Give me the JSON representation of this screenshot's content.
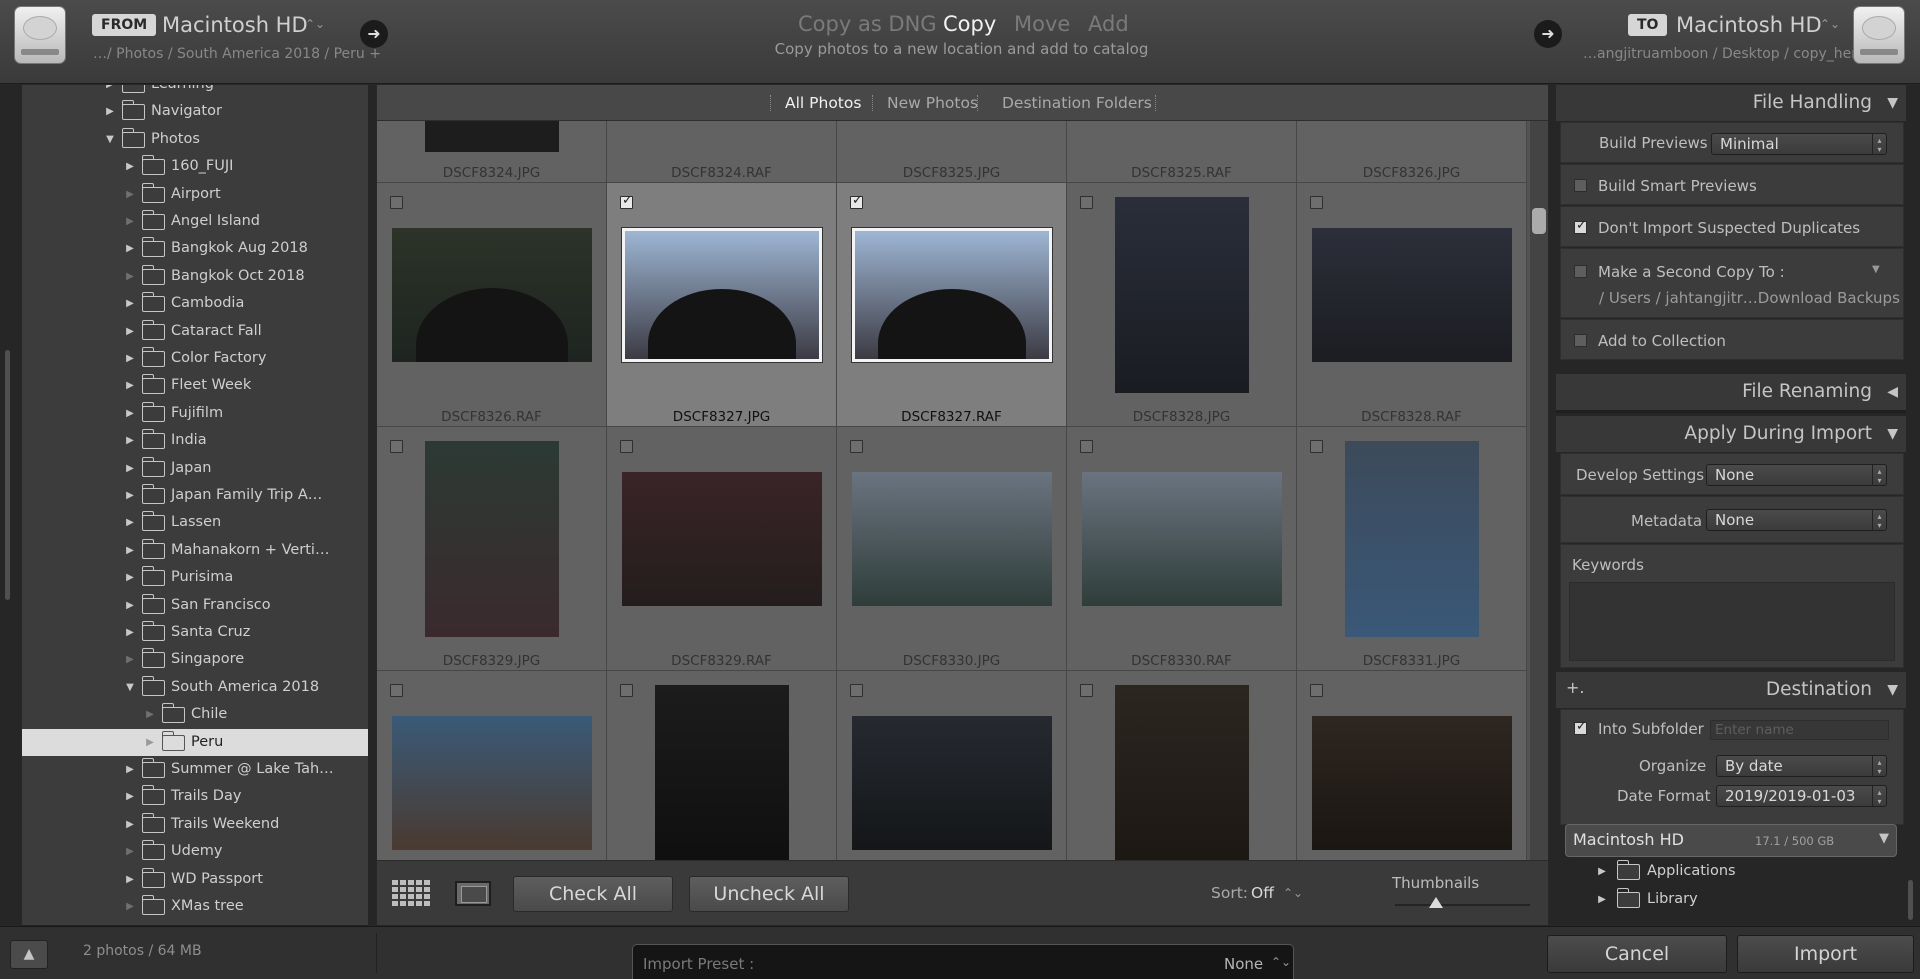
{
  "header": {
    "from_tag": "FROM",
    "from_volume": "Macintosh HD",
    "from_path": "…/ Photos / South America 2018 / Peru +",
    "modes": [
      "Copy as DNG",
      "Copy",
      "Move",
      "Add"
    ],
    "active_mode": "Copy",
    "mode_description": "Copy photos to a new location and add to catalog",
    "to_tag": "TO",
    "to_volume": "Macintosh HD",
    "to_path": "…angjitruamboon / Desktop / copy_here"
  },
  "source_tree": [
    {
      "label": "Learning",
      "depth": 1,
      "expander": "closed"
    },
    {
      "label": "Navigator",
      "depth": 1,
      "expander": "closed"
    },
    {
      "label": "Photos",
      "depth": 1,
      "expander": "open"
    },
    {
      "label": "160_FUJI",
      "depth": 2,
      "expander": "closed"
    },
    {
      "label": "Airport",
      "depth": 2,
      "expander": "none"
    },
    {
      "label": "Angel Island",
      "depth": 2,
      "expander": "none"
    },
    {
      "label": "Bangkok Aug 2018",
      "depth": 2,
      "expander": "closed"
    },
    {
      "label": "Bangkok Oct 2018",
      "depth": 2,
      "expander": "none"
    },
    {
      "label": "Cambodia",
      "depth": 2,
      "expander": "closed"
    },
    {
      "label": "Cataract Fall",
      "depth": 2,
      "expander": "closed"
    },
    {
      "label": "Color Factory",
      "depth": 2,
      "expander": "closed"
    },
    {
      "label": "Fleet Week",
      "depth": 2,
      "expander": "closed"
    },
    {
      "label": "Fujifilm",
      "depth": 2,
      "expander": "closed"
    },
    {
      "label": "India",
      "depth": 2,
      "expander": "closed"
    },
    {
      "label": "Japan",
      "depth": 2,
      "expander": "closed"
    },
    {
      "label": "Japan Family Trip  A…",
      "depth": 2,
      "expander": "closed"
    },
    {
      "label": "Lassen",
      "depth": 2,
      "expander": "closed"
    },
    {
      "label": "Mahanakorn + Verti…",
      "depth": 2,
      "expander": "closed"
    },
    {
      "label": "Purisima",
      "depth": 2,
      "expander": "closed"
    },
    {
      "label": "San Francisco",
      "depth": 2,
      "expander": "closed"
    },
    {
      "label": "Santa Cruz",
      "depth": 2,
      "expander": "closed"
    },
    {
      "label": "Singapore",
      "depth": 2,
      "expander": "none"
    },
    {
      "label": "South America 2018",
      "depth": 2,
      "expander": "open"
    },
    {
      "label": "Chile",
      "depth": 3,
      "expander": "none"
    },
    {
      "label": "Peru",
      "depth": 3,
      "expander": "none",
      "selected": true
    },
    {
      "label": "Summer @ Lake Tah…",
      "depth": 2,
      "expander": "closed"
    },
    {
      "label": "Trails Day",
      "depth": 2,
      "expander": "closed"
    },
    {
      "label": "Trails Weekend",
      "depth": 2,
      "expander": "closed"
    },
    {
      "label": "Udemy",
      "depth": 2,
      "expander": "none"
    },
    {
      "label": "WD Passport",
      "depth": 2,
      "expander": "closed"
    },
    {
      "label": "XMas tree",
      "depth": 2,
      "expander": "none"
    }
  ],
  "view_tabs": [
    "All Photos",
    "New Photos",
    "Destination Folders"
  ],
  "active_view_tab": "All Photos",
  "photos_top_row": [
    "DSCF8324.JPG",
    "DSCF8324.RAF",
    "DSCF8325.JPG",
    "DSCF8325.RAF",
    "DSCF8326.JPG"
  ],
  "photos": [
    {
      "name": "DSCF8326.RAF",
      "checked": false,
      "orientation": "landscape",
      "tone": [
        "#2c3328",
        "#1e2420"
      ]
    },
    {
      "name": "DSCF8327.JPG",
      "checked": true,
      "orientation": "landscape",
      "tone": [
        "#9eb6d4",
        "#3c3b44"
      ]
    },
    {
      "name": "DSCF8327.RAF",
      "checked": true,
      "orientation": "landscape",
      "tone": [
        "#9eb6d4",
        "#3c3b44"
      ]
    },
    {
      "name": "DSCF8328.JPG",
      "checked": false,
      "orientation": "portrait",
      "tone": [
        "#2a2e3a",
        "#1a1c22"
      ]
    },
    {
      "name": "DSCF8328.RAF",
      "checked": false,
      "orientation": "landscape",
      "tone": [
        "#2c2f3a",
        "#1c1d22"
      ]
    },
    {
      "name": "DSCF8329.JPG",
      "checked": false,
      "orientation": "portrait",
      "tone": [
        "#2c3a34",
        "#3a2a2e"
      ]
    },
    {
      "name": "DSCF8329.RAF",
      "checked": false,
      "orientation": "landscape",
      "tone": [
        "#3a2427",
        "#241d1d"
      ]
    },
    {
      "name": "DSCF8330.JPG",
      "checked": false,
      "orientation": "landscape",
      "tone": [
        "#6a7480",
        "#2f3d3a"
      ]
    },
    {
      "name": "DSCF8330.RAF",
      "checked": false,
      "orientation": "landscape",
      "tone": [
        "#6a7480",
        "#2f3d3a"
      ]
    },
    {
      "name": "DSCF8331.JPG",
      "checked": false,
      "orientation": "portrait",
      "tone": [
        "#3c4a5a",
        "#3a5878"
      ]
    },
    {
      "name": "",
      "checked": false,
      "orientation": "landscape",
      "tone": [
        "#3a5a78",
        "#4a3a30"
      ]
    },
    {
      "name": "",
      "checked": false,
      "orientation": "portrait",
      "tone": [
        "#1c1c1c",
        "#0e0e0e"
      ]
    },
    {
      "name": "",
      "checked": false,
      "orientation": "landscape",
      "tone": [
        "#262a30",
        "#141618"
      ]
    },
    {
      "name": "",
      "checked": false,
      "orientation": "portrait",
      "tone": [
        "#2c2620",
        "#1a1612"
      ]
    },
    {
      "name": "",
      "checked": false,
      "orientation": "landscape",
      "tone": [
        "#2e2620",
        "#1a1612"
      ]
    }
  ],
  "grid_toolbar": {
    "check_all": "Check All",
    "uncheck_all": "Uncheck All",
    "sort_label": "Sort:",
    "sort_value": "Off",
    "thumbnails_label": "Thumbnails",
    "thumbnail_size": 0.3
  },
  "file_handling": {
    "title": "File Handling",
    "build_previews_label": "Build Previews",
    "build_previews_value": "Minimal",
    "build_smart_previews": {
      "label": "Build Smart Previews",
      "checked": false
    },
    "dont_import_duplicates": {
      "label": "Don't Import Suspected Duplicates",
      "checked": true
    },
    "second_copy": {
      "label": "Make a Second Copy To :",
      "checked": false,
      "path": "/ Users / jahtangjitr…Download Backups"
    },
    "add_to_collection": {
      "label": "Add to Collection",
      "checked": false
    }
  },
  "file_renaming": {
    "title": "File Renaming"
  },
  "apply_during_import": {
    "title": "Apply During Import",
    "develop_label": "Develop Settings",
    "develop_value": "None",
    "metadata_label": "Metadata",
    "metadata_value": "None",
    "keywords_label": "Keywords"
  },
  "destination": {
    "add_icon": "+.",
    "title": "Destination",
    "into_subfolder": {
      "label": "Into Subfolder",
      "checked": true,
      "placeholder": "Enter name"
    },
    "organize_label": "Organize",
    "organize_value": "By date",
    "date_format_label": "Date Format",
    "date_format_value": "2019/2019-01-03",
    "volume_name": "Macintosh HD",
    "volume_space": "17.1 / 500 GB",
    "folders": [
      "Applications",
      "Library"
    ]
  },
  "footer": {
    "status": "2 photos / 64 MB",
    "import_preset_label": "Import Preset :",
    "import_preset_value": "None",
    "cancel": "Cancel",
    "import": "Import"
  },
  "icons": [
    "hard-drive-icon",
    "arrow-right-icon",
    "disclosure-triangle-icon",
    "folder-icon",
    "grid-view-icon",
    "loupe-view-icon",
    "expand-up-icon"
  ]
}
